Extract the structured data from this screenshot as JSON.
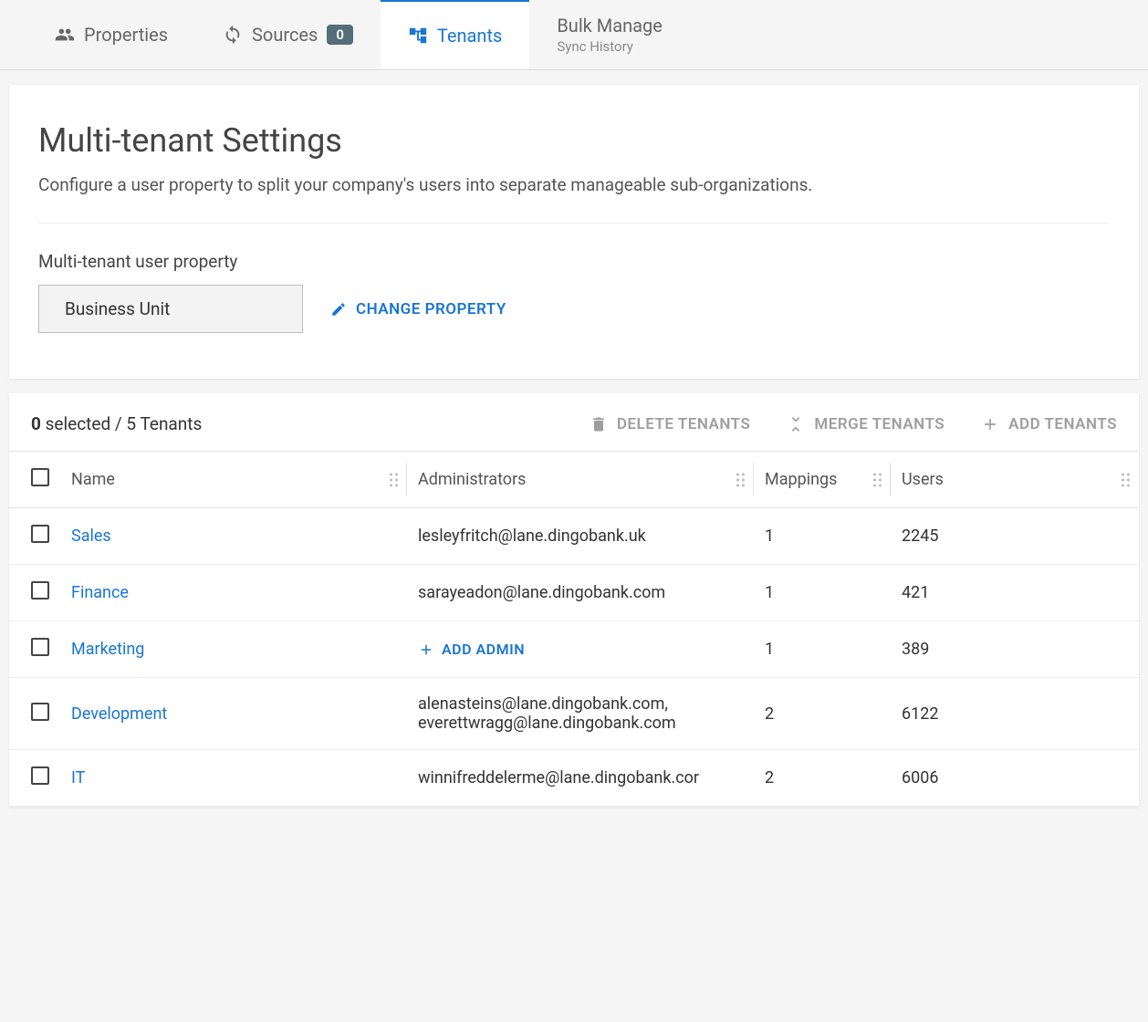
{
  "tabs": {
    "properties": "Properties",
    "sources": "Sources",
    "sources_badge": "0",
    "tenants": "Tenants",
    "bulk_manage": "Bulk Manage",
    "bulk_manage_sub": "Sync History"
  },
  "settings": {
    "title": "Multi-tenant Settings",
    "description": "Configure a user property to split your company's users into separate manageable sub-organizations.",
    "property_label": "Multi-tenant user property",
    "property_value": "Business Unit",
    "change_property": "CHANGE PROPERTY"
  },
  "toolbar": {
    "selected_count": "0",
    "selected_word": "selected",
    "total_text": "/ 5 Tenants",
    "delete": "DELETE TENANTS",
    "merge": "MERGE TENANTS",
    "add": "ADD TENANTS"
  },
  "columns": {
    "name": "Name",
    "administrators": "Administrators",
    "mappings": "Mappings",
    "users": "Users"
  },
  "add_admin_label": "ADD ADMIN",
  "rows": [
    {
      "name": "Sales",
      "admin": "lesleyfritch@lane.dingobank.uk",
      "mappings": "1",
      "users": "2245"
    },
    {
      "name": "Finance",
      "admin": "sarayeadon@lane.dingobank.com",
      "mappings": "1",
      "users": "421"
    },
    {
      "name": "Marketing",
      "admin": "",
      "mappings": "1",
      "users": "389"
    },
    {
      "name": "Development",
      "admin": "alenasteins@lane.dingobank.com, everettwragg@lane.dingobank.com",
      "mappings": "2",
      "users": "6122"
    },
    {
      "name": "IT",
      "admin": "winnifreddelerme@lane.dingobank.cor",
      "mappings": "2",
      "users": "6006"
    }
  ]
}
